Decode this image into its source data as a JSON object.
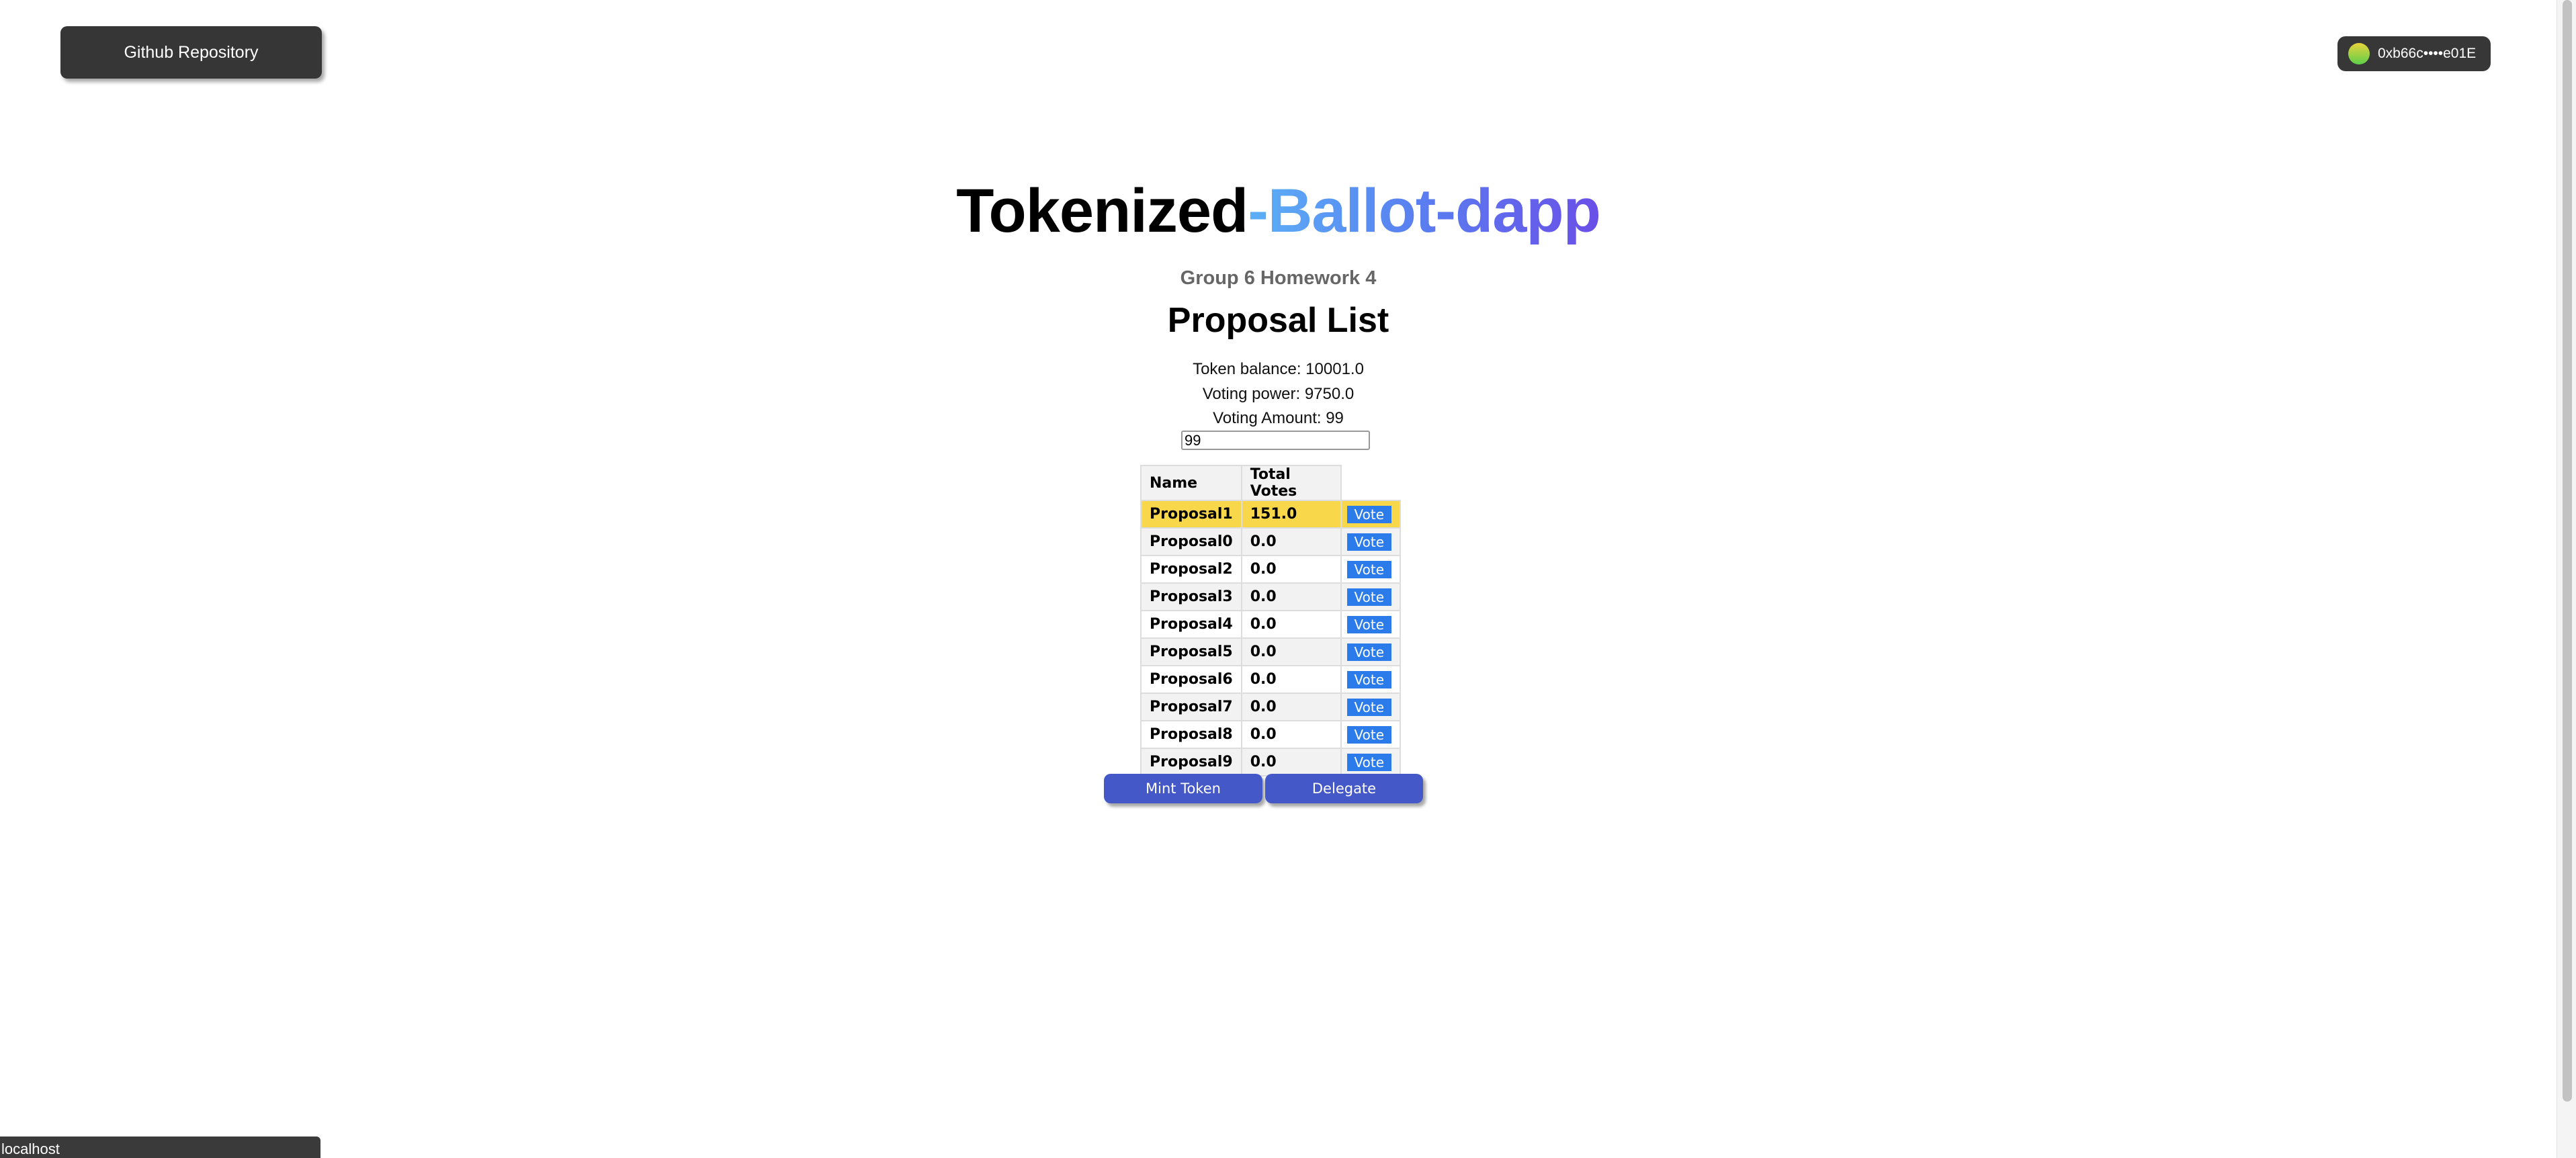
{
  "header": {
    "github_label": "Github Repository",
    "wallet_address": "0xb66c••••e01E"
  },
  "title": {
    "part1": "Tokenized",
    "part2": "-Ballot-dapp"
  },
  "subtitle": "Group 6 Homework 4",
  "heading": "Proposal List",
  "info": {
    "token_balance": "Token balance: 10001.0",
    "voting_power": "Voting power: 9750.0",
    "voting_amount": "Voting Amount: 99",
    "amount_input": "99"
  },
  "table": {
    "headers": [
      "Name",
      "Total Votes"
    ],
    "vote_label": "Vote",
    "rows": [
      [
        "Proposal1",
        "151.0"
      ],
      [
        "Proposal0",
        "0.0"
      ],
      [
        "Proposal2",
        "0.0"
      ],
      [
        "Proposal3",
        "0.0"
      ],
      [
        "Proposal4",
        "0.0"
      ],
      [
        "Proposal5",
        "0.0"
      ],
      [
        "Proposal6",
        "0.0"
      ],
      [
        "Proposal7",
        "0.0"
      ],
      [
        "Proposal8",
        "0.0"
      ],
      [
        "Proposal9",
        "0.0"
      ]
    ]
  },
  "actions": {
    "mint": "Mint Token",
    "delegate": "Delegate"
  },
  "status_bar": "localhost"
}
